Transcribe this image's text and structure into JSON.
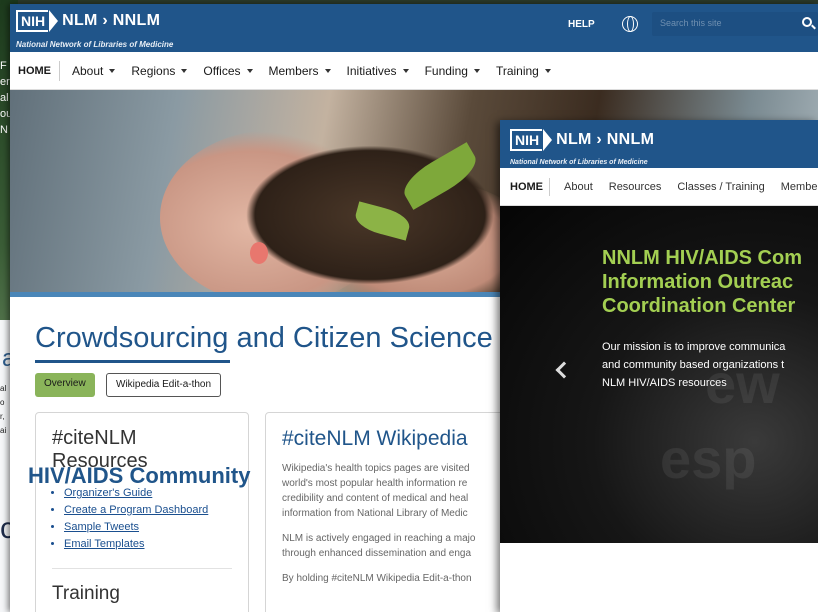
{
  "bg_window": {
    "strips": [
      "F",
      "er",
      "al",
      "ou",
      "N"
    ],
    "big_letter": "c",
    "mid_letter": "a",
    "fragments": [
      "al",
      "o",
      "r,",
      "ai"
    ]
  },
  "main_window": {
    "logo": {
      "nih": "NIH",
      "nlm": "NLM › NNLM"
    },
    "tagline": "National Network of Libraries of Medicine",
    "help": "HELP",
    "search_placeholder": "Search this site",
    "nav": [
      {
        "label": "HOME",
        "dropdown": false
      },
      {
        "label": "About",
        "dropdown": true
      },
      {
        "label": "Regions",
        "dropdown": true
      },
      {
        "label": "Offices",
        "dropdown": true
      },
      {
        "label": "Members",
        "dropdown": true
      },
      {
        "label": "Initiatives",
        "dropdown": true
      },
      {
        "label": "Funding",
        "dropdown": true
      },
      {
        "label": "Training",
        "dropdown": true
      }
    ],
    "page_title": "Crowdsourcing and Citizen Science",
    "tabs": {
      "active": "Overview",
      "other": "Wikipedia Edit-a-thon"
    },
    "resources_card": {
      "title": "#citeNLM Resources",
      "links": [
        "Organizer's Guide",
        "Create a Program Dashboard",
        "Sample Tweets",
        "Email Templates"
      ],
      "section2": "Training"
    },
    "content_card": {
      "title": "#citeNLM Wikipedia",
      "lines": [
        "Wikipedia's health topics pages are visited",
        "world's most popular health information re",
        "credibility and content of medical and heal",
        "information from National Library of Medic",
        "NLM is actively engaged in reaching a majo",
        "through enhanced dissemination and enga",
        "By holding #citeNLM Wikipedia Edit-a-thon"
      ]
    }
  },
  "front_window": {
    "logo": {
      "nih": "NIH",
      "nlm": "NLM › NNLM"
    },
    "tagline": "National Network of Libraries of Medicine",
    "nav": [
      "HOME",
      "About",
      "Resources",
      "Classes / Training",
      "Membe"
    ],
    "hero_title_lines": [
      "NNLM HIV/AIDS Com",
      "Information Outreac",
      "Coordination Center"
    ],
    "hero_text_lines": [
      "Our mission is to improve communica",
      "and community based organizations t",
      "NLM HIV/AIDS resources"
    ],
    "ghost_text": [
      "ew",
      "esp"
    ],
    "heading": "HIV/AIDS Community"
  },
  "colors": {
    "brand_blue": "#20558a",
    "accent_green": "#8ab45a",
    "hero_green": "#a3cf52"
  }
}
